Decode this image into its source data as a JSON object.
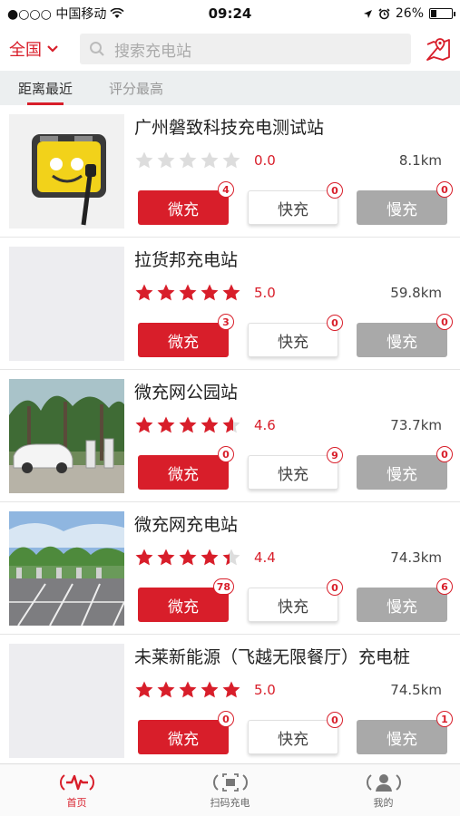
{
  "status_bar": {
    "carrier": "●○○○ 中国移动",
    "time": "09:24",
    "battery": "26%",
    "battery_level": 0.26
  },
  "header": {
    "region": "全国",
    "search_placeholder": "搜索充电站"
  },
  "tabs": [
    {
      "label": "距离最近",
      "active": true
    },
    {
      "label": "评分最高",
      "active": false
    }
  ],
  "colors": {
    "accent": "#d81e2a",
    "star_empty": "#dddddd"
  },
  "stations": [
    {
      "name": "广州磐致科技充电测试站",
      "rating": 0.0,
      "rating_text": "0.0",
      "distance": "8.1km",
      "image": "charger-photo",
      "buttons": {
        "micro": {
          "label": "微充",
          "count": "4"
        },
        "fast": {
          "label": "快充",
          "count": "0"
        },
        "slow": {
          "label": "慢充",
          "count": "0"
        }
      }
    },
    {
      "name": "拉货邦充电站",
      "rating": 5.0,
      "rating_text": "5.0",
      "distance": "59.8km",
      "image": "placeholder",
      "buttons": {
        "micro": {
          "label": "微充",
          "count": "3"
        },
        "fast": {
          "label": "快充",
          "count": "0"
        },
        "slow": {
          "label": "慢充",
          "count": "0"
        }
      }
    },
    {
      "name": "微充网公园站",
      "rating": 4.6,
      "rating_text": "4.6",
      "distance": "73.7km",
      "image": "park-photo",
      "buttons": {
        "micro": {
          "label": "微充",
          "count": "0"
        },
        "fast": {
          "label": "快充",
          "count": "9"
        },
        "slow": {
          "label": "慢充",
          "count": "0"
        }
      }
    },
    {
      "name": "微充网充电站",
      "rating": 4.4,
      "rating_text": "4.4",
      "distance": "74.3km",
      "image": "parking-photo",
      "buttons": {
        "micro": {
          "label": "微充",
          "count": "78"
        },
        "fast": {
          "label": "快充",
          "count": "0"
        },
        "slow": {
          "label": "慢充",
          "count": "6"
        }
      }
    },
    {
      "name": "未莱新能源（飞越无限餐厅）充电桩",
      "rating": 5.0,
      "rating_text": "5.0",
      "distance": "74.5km",
      "image": "placeholder",
      "buttons": {
        "micro": {
          "label": "微充",
          "count": "0"
        },
        "fast": {
          "label": "快充",
          "count": "0"
        },
        "slow": {
          "label": "慢充",
          "count": "1"
        }
      }
    }
  ],
  "tabbar": [
    {
      "label": "首页",
      "icon": "home-pulse-icon",
      "active": true
    },
    {
      "label": "扫码充电",
      "icon": "scan-icon",
      "active": false
    },
    {
      "label": "我的",
      "icon": "profile-icon",
      "active": false
    }
  ]
}
